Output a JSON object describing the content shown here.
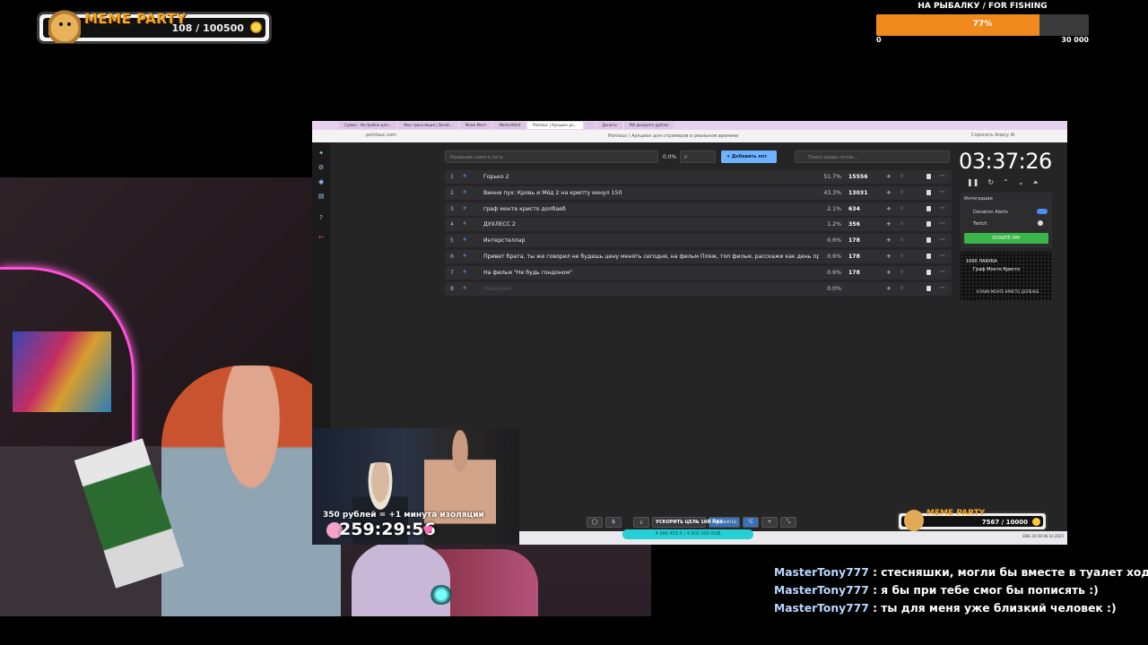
{
  "meme_party": {
    "title": "MEME PARTY",
    "count": "108 / 100500"
  },
  "goal": {
    "title": "НА РЫБАЛКУ / FOR FISHING",
    "percent_label": "77%",
    "progress": 0.77,
    "min": "0",
    "max": "30 000"
  },
  "browser": {
    "tabs": [
      "Сумма - На пробно для...",
      "Мне трансляция | Donat...",
      "Меме-Мент",
      "Meme-Ment",
      "Pointauc | Аукцион дл...",
      "",
      "Донаты",
      "PW донорате рублях"
    ],
    "url": "pointauc.com",
    "page_title": "Pointauc | Аукцион для стримеров в реальном времени",
    "ask": "Спросить Алису AI"
  },
  "auction": {
    "new_lot_placeholder": "Название нового лота",
    "new_lot_percent": "0.0%",
    "new_lot_sum_placeholder": "₽",
    "add_button": "+ Добавить лот",
    "search_placeholder": "Поиск среди лотов...",
    "lots": [
      {
        "num": "1",
        "name": "Горько 2",
        "percent": "51.7%",
        "amount": "15556"
      },
      {
        "num": "2",
        "name": "Винни пух: Кровь и Мёд 2 на крипту кинул 150",
        "percent": "43.3%",
        "amount": "13031"
      },
      {
        "num": "3",
        "name": "граф монте кристо долбаеб",
        "percent": "2.1%",
        "amount": "634"
      },
      {
        "num": "4",
        "name": "ДУХЛЕСС 2",
        "percent": "1.2%",
        "amount": "356"
      },
      {
        "num": "5",
        "name": "Интерстеллар",
        "percent": "0.6%",
        "amount": "178"
      },
      {
        "num": "6",
        "name": "Привет брата, ты же говорил не будешь цену менять сегодня, на фильм Пляж, топ фильм, расскажи как день прош",
        "percent": "0.6%",
        "amount": "178"
      },
      {
        "num": "7",
        "name": "На фильм \"Не будь гондоном\"",
        "percent": "0.6%",
        "amount": "178"
      },
      {
        "num": "8",
        "name": "Название",
        "percent": "0.0%",
        "amount": ""
      }
    ],
    "timer": "03:37:26",
    "integrations": {
      "title": "Интеграции",
      "donation_alerts": "Donation Alerts",
      "twitch": "Twitch",
      "donate": "DONATE PAY"
    },
    "alert": {
      "line1": "1000 ЛАБУБА",
      "line2": "Граф Монте Кристо",
      "line3": "КЛАИН МОНТЕ КРИСТО ДОЛБАЕБ"
    },
    "speedup": "УСКОРИТЬ ЦЕЛЬ 10Й РАЗ",
    "rules_button": "Правила",
    "progress_text": "4 066 453.5 / 4 800 000 RUB",
    "tray": "ENG  20:59  06.10.2025"
  },
  "mini_meme": {
    "title": "MEME PARTY",
    "count": "7567 / 10000"
  },
  "cam2": {
    "info": "350 рублей = +1 минута изоляции",
    "countdown": "259:29:56"
  },
  "chat": [
    {
      "user": "MasterTony777",
      "text": ": стесняшки, могли бы вместе в туалет ходить :)"
    },
    {
      "user": "MasterTony777",
      "text": ": я бы при тебе смог бы пописять :)"
    },
    {
      "user": "MasterTony777",
      "text": ": ты для меня уже близкий человек :)"
    }
  ],
  "colors": {
    "goal_fill": "#f08a1c",
    "accent_blue": "#6fb2ff",
    "progress_cyan": "#24d0d6",
    "meme_orange": "#f6a623"
  }
}
